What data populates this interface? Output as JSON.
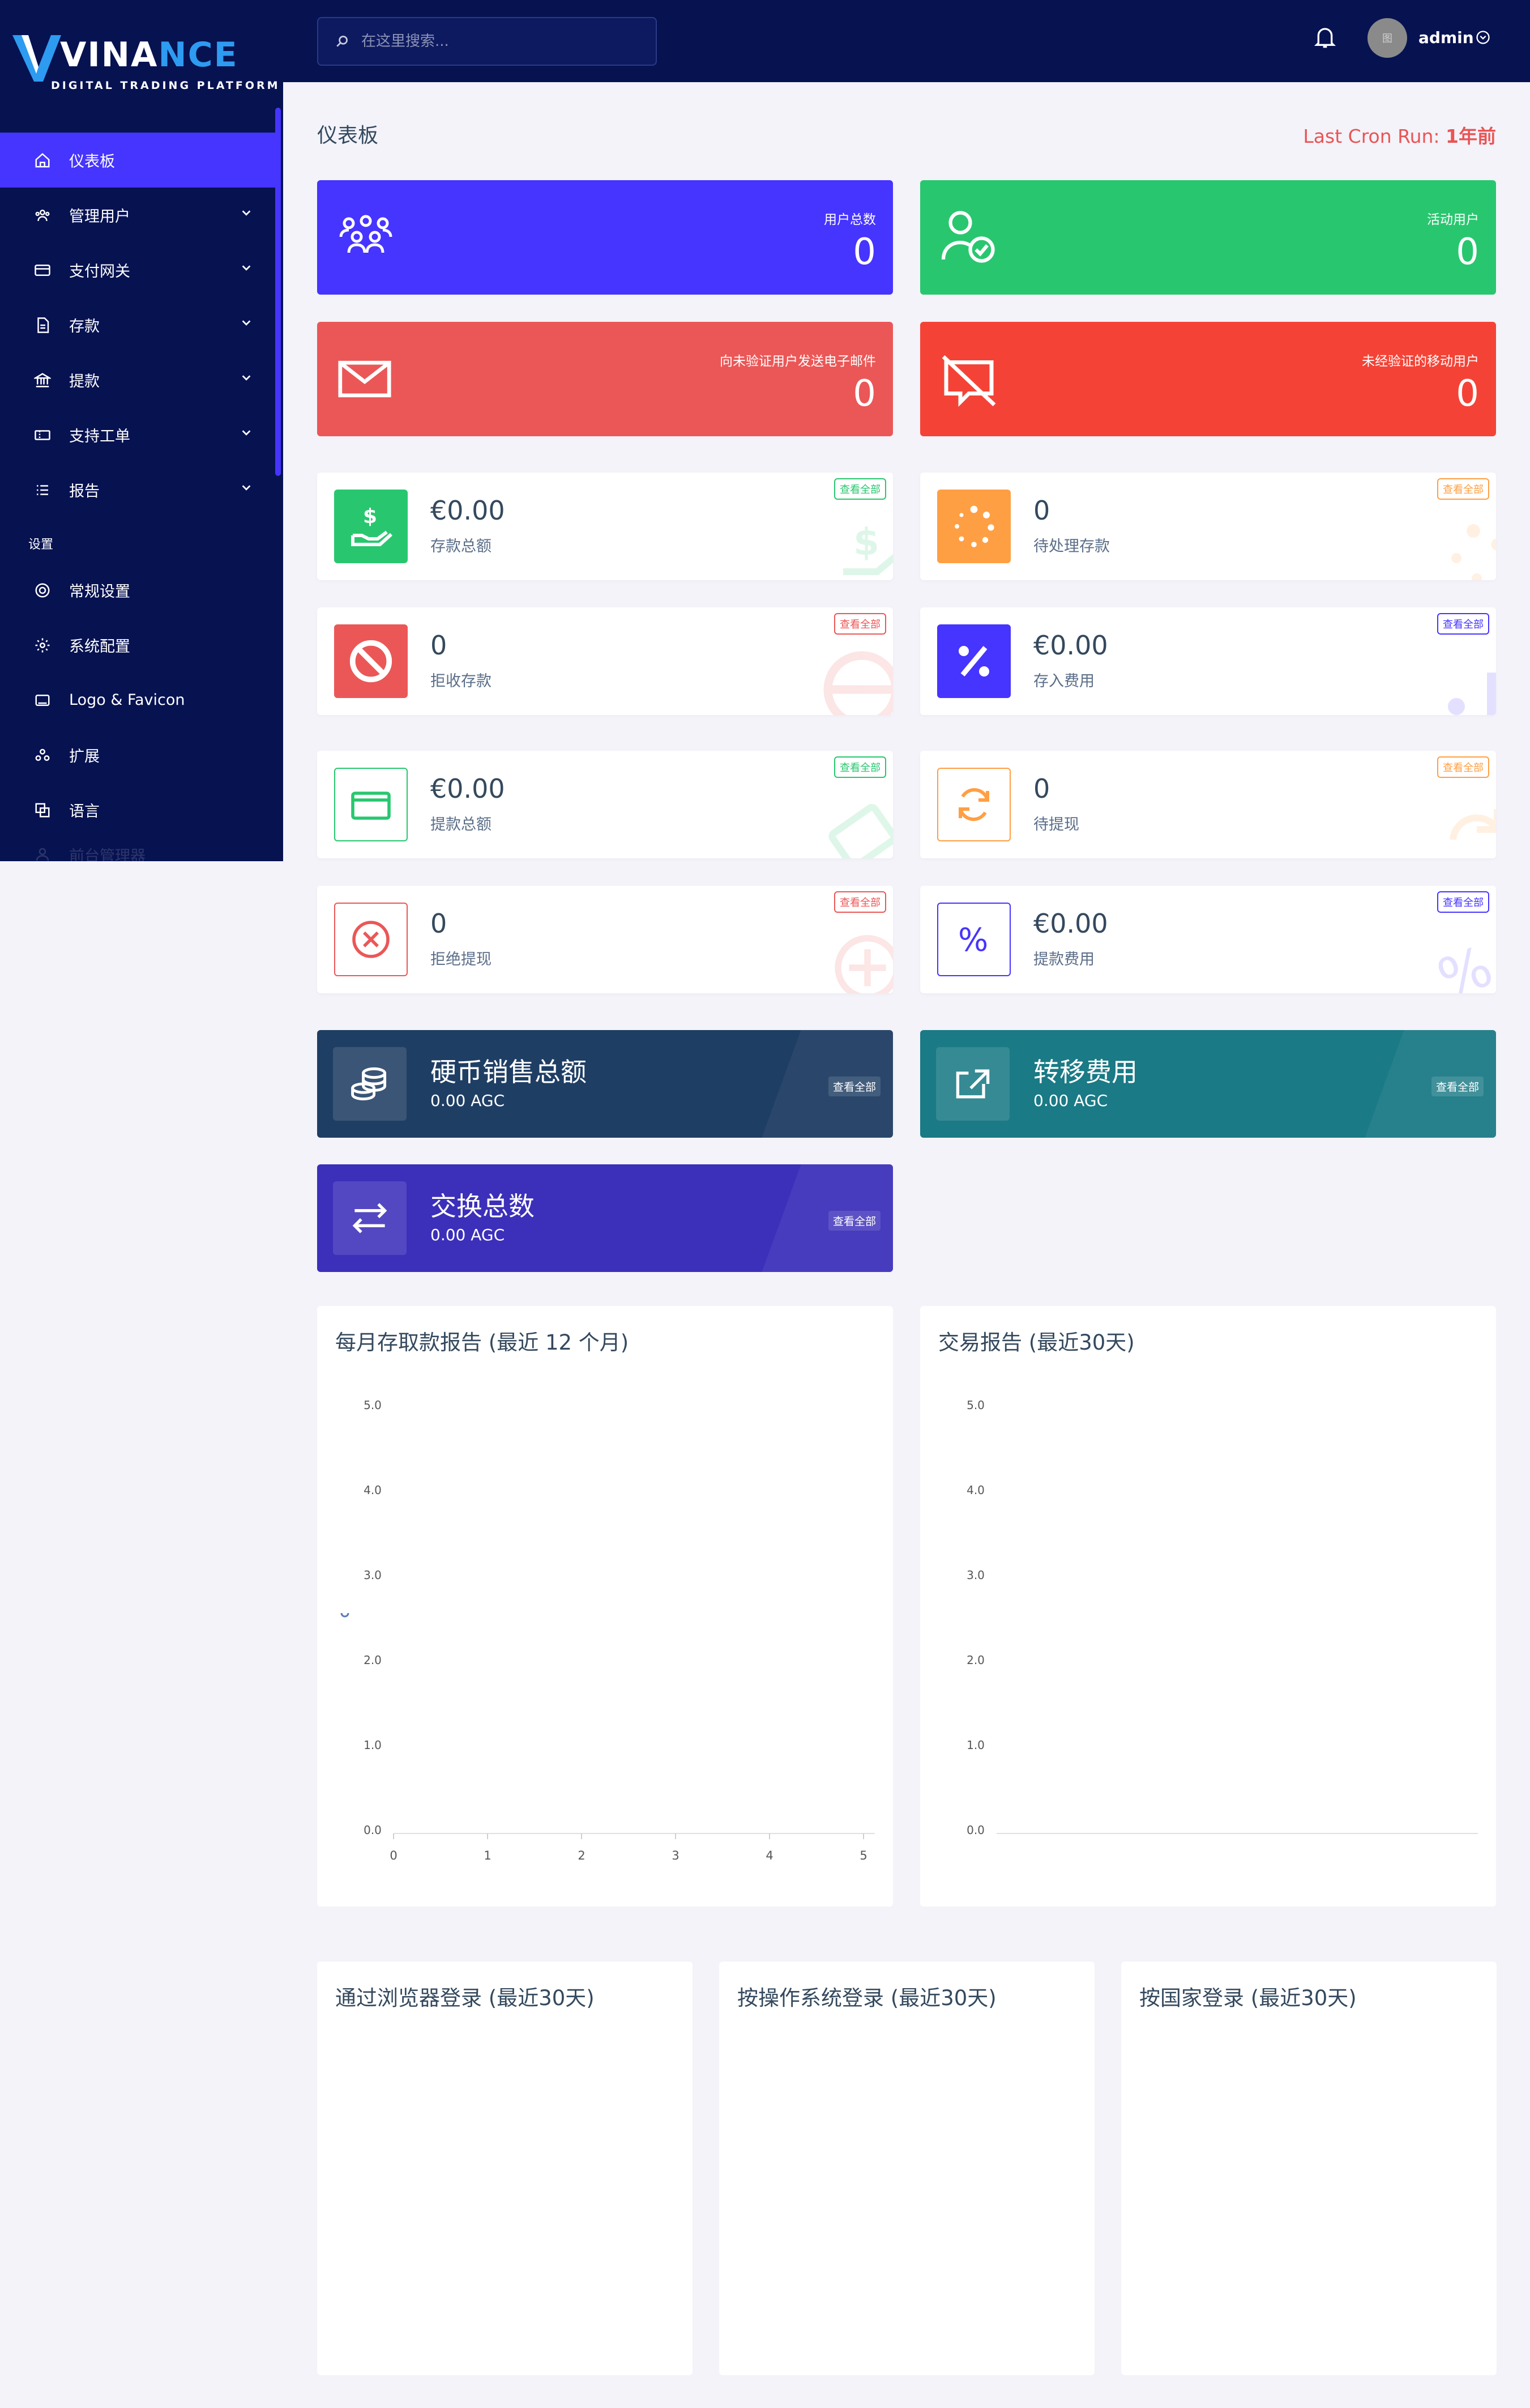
{
  "brand": {
    "name_a": "VINA",
    "name_b": "NCE",
    "tagline": "DIGITAL TRADING PLATFORM"
  },
  "header": {
    "search_placeholder": "在这里搜索...",
    "avatar_alt": "图",
    "user": "admin"
  },
  "sidebar": {
    "items": [
      {
        "label": "仪表板",
        "icon": "home-icon"
      },
      {
        "label": "管理用户",
        "icon": "users-icon"
      },
      {
        "label": "支付网关",
        "icon": "credit-card-icon"
      },
      {
        "label": "存款",
        "icon": "file-icon"
      },
      {
        "label": "提款",
        "icon": "bank-icon"
      },
      {
        "label": "支持工单",
        "icon": "ticket-icon"
      },
      {
        "label": "报告",
        "icon": "list-icon"
      }
    ],
    "section": "设置",
    "settings": [
      {
        "label": "常规设置",
        "icon": "life-ring-icon"
      },
      {
        "label": "系统配置",
        "icon": "gear-icon"
      },
      {
        "label": "Logo & Favicon",
        "icon": "image-icon"
      },
      {
        "label": "扩展",
        "icon": "cubes-icon"
      },
      {
        "label": "语言",
        "icon": "language-icon"
      },
      {
        "label": "前台管理器",
        "icon": "user-icon"
      }
    ]
  },
  "page": {
    "title": "仪表板",
    "cron_label": "Last Cron Run:",
    "cron_value": "1年前"
  },
  "stats": [
    {
      "label": "用户总数",
      "value": "0",
      "color": "#4634ff"
    },
    {
      "label": "活动用户",
      "value": "0",
      "color": "#28c76f"
    },
    {
      "label": "向未验证用户发送电子邮件",
      "value": "0",
      "color": "#eb5757"
    },
    {
      "label": "未经验证的移动用户",
      "value": "0",
      "color": "#f44336"
    }
  ],
  "widgets": [
    {
      "value": "€0.00",
      "label": "存款总额",
      "link": "查看全部",
      "color": "#28c76f"
    },
    {
      "value": "0",
      "label": "待处理存款",
      "link": "查看全部",
      "color": "#ff9f43"
    },
    {
      "value": "0",
      "label": "拒收存款",
      "link": "查看全部",
      "color": "#eb5757"
    },
    {
      "value": "€0.00",
      "label": "存入费用",
      "link": "查看全部",
      "color": "#4634ff"
    },
    {
      "value": "€0.00",
      "label": "提款总额",
      "link": "查看全部",
      "color": "#28c76f"
    },
    {
      "value": "0",
      "label": "待提现",
      "link": "查看全部",
      "color": "#ff9f43"
    },
    {
      "value": "0",
      "label": "拒绝提现",
      "link": "查看全部",
      "color": "#eb5757"
    },
    {
      "value": "€0.00",
      "label": "提款费用",
      "link": "查看全部",
      "color": "#4634ff"
    }
  ],
  "dark_widgets": [
    {
      "title": "硬币销售总额",
      "value": "0.00 AGC",
      "link": "查看全部",
      "color": "#1f3e64"
    },
    {
      "title": "转移费用",
      "value": "0.00 AGC",
      "link": "查看全部",
      "color": "#1a7a85"
    },
    {
      "title": "交换总数",
      "value": "0.00 AGC",
      "link": "查看全部",
      "color": "#3c2fba"
    }
  ],
  "panels": {
    "monthly": "每月存取款报告 (最近 12 个月)",
    "transactions": "交易报告 (最近30天)",
    "browser": "通过浏览器登录 (最近30天)",
    "os": "按操作系统登录 (最近30天)",
    "country": "按国家登录 (最近30天)"
  },
  "chart_data": [
    {
      "type": "line",
      "title": "每月存取款报告 (最近 12 个月)",
      "x": [
        0,
        1,
        2,
        3,
        4,
        5
      ],
      "y_ticks": [
        "0.0",
        "1.0",
        "2.0",
        "3.0",
        "4.0",
        "5.0"
      ],
      "ylim": [
        0,
        5
      ],
      "xlim": [
        0,
        5
      ],
      "series": [],
      "grid": false
    },
    {
      "type": "line",
      "title": "交易报告 (最近30天)",
      "x": [],
      "y_ticks": [
        "0.0",
        "1.0",
        "2.0",
        "3.0",
        "4.0",
        "5.0"
      ],
      "ylim": [
        0,
        5
      ],
      "series": [],
      "grid": false
    }
  ]
}
